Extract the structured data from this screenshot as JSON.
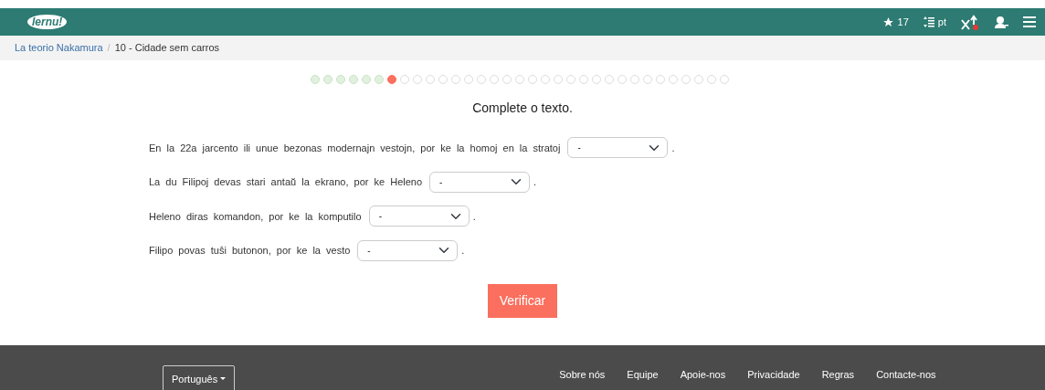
{
  "navbar": {
    "logo": "lernu!",
    "stars": "17",
    "language": "pt",
    "notification": true
  },
  "breadcrumb": {
    "parent": "La teorio Nakamura",
    "separator": "/",
    "current": "10 - Cidade sem carros"
  },
  "progress": [
    {
      "completed": true,
      "selected": false
    },
    {
      "completed": true,
      "selected": false
    },
    {
      "completed": true,
      "selected": false
    },
    {
      "completed": true,
      "selected": false
    },
    {
      "completed": true,
      "selected": false
    },
    {
      "completed": true,
      "selected": false
    },
    {
      "completed": false,
      "selected": true
    },
    {
      "completed": false,
      "selected": false
    },
    {
      "completed": false,
      "selected": false
    },
    {
      "completed": false,
      "selected": false
    },
    {
      "completed": false,
      "selected": false
    },
    {
      "completed": false,
      "selected": false
    },
    {
      "completed": false,
      "selected": false
    },
    {
      "completed": false,
      "selected": false
    },
    {
      "completed": false,
      "selected": false
    },
    {
      "completed": false,
      "selected": false
    },
    {
      "completed": false,
      "selected": false
    },
    {
      "completed": false,
      "selected": false
    },
    {
      "completed": false,
      "selected": false
    },
    {
      "completed": false,
      "selected": false
    },
    {
      "completed": false,
      "selected": false
    },
    {
      "completed": false,
      "selected": false
    },
    {
      "completed": false,
      "selected": false
    },
    {
      "completed": false,
      "selected": false
    },
    {
      "completed": false,
      "selected": false
    },
    {
      "completed": false,
      "selected": false
    },
    {
      "completed": false,
      "selected": false
    },
    {
      "completed": false,
      "selected": false
    },
    {
      "completed": false,
      "selected": false
    },
    {
      "completed": false,
      "selected": false
    },
    {
      "completed": false,
      "selected": false
    },
    {
      "completed": false,
      "selected": false
    },
    {
      "completed": false,
      "selected": false
    }
  ],
  "title": "Complete o texto.",
  "questions": [
    {
      "text": "En la 22a jarcento ili unue bezonas modernajn vestojn, por ke la homoj en la stratoj",
      "value": "-",
      "end": "."
    },
    {
      "text": "La du Filipoj devas stari antaŭ la ekrano, por ke Heleno",
      "value": "-",
      "end": "."
    },
    {
      "text": "Heleno diras komandon, por ke la komputilo",
      "value": "-",
      "end": "."
    },
    {
      "text": "Filipo povas tuŝi butonon, por ke la vesto",
      "value": "-",
      "end": "."
    }
  ],
  "check_button": "Verificar",
  "footer": {
    "language": "Português",
    "links": [
      "Sobre nós",
      "Equipe",
      "Apoie-nos",
      "Privacidade",
      "Regras",
      "Contacte-nos"
    ]
  }
}
